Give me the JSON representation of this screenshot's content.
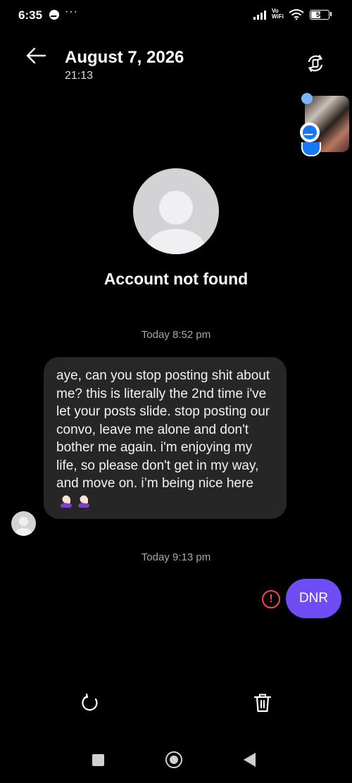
{
  "status_bar": {
    "time": "6:35",
    "more": "···",
    "network": "Vo WiFi",
    "battery": "56"
  },
  "header": {
    "title": "August 7, 2026",
    "subtitle": "21:13"
  },
  "profile": {
    "name": "Account not found"
  },
  "conversation": {
    "timestamp_1": "Today 8:52 pm",
    "incoming_message": "aye, can you stop posting shit about me? this is literally the 2nd time i've let your posts slide. stop posting our convo, leave me alone and don't bother me again. i'm enjoying my life, so please don't get in my way, and move on. i’m being nice here",
    "timestamp_2": "Today 9:13 pm",
    "outgoing_message": "DNR",
    "error_symbol": "!"
  },
  "colors": {
    "background": "#000000",
    "incoming_bubble": "#262626",
    "outgoing_bubble": "#6f4df5",
    "error": "#f04b4b",
    "messenger_blue": "#1877f2"
  },
  "icons": [
    "back-arrow-icon",
    "rotate-screen-icon",
    "messenger-icon",
    "retry-icon",
    "trash-icon",
    "error-icon",
    "facepalm-emoji"
  ]
}
